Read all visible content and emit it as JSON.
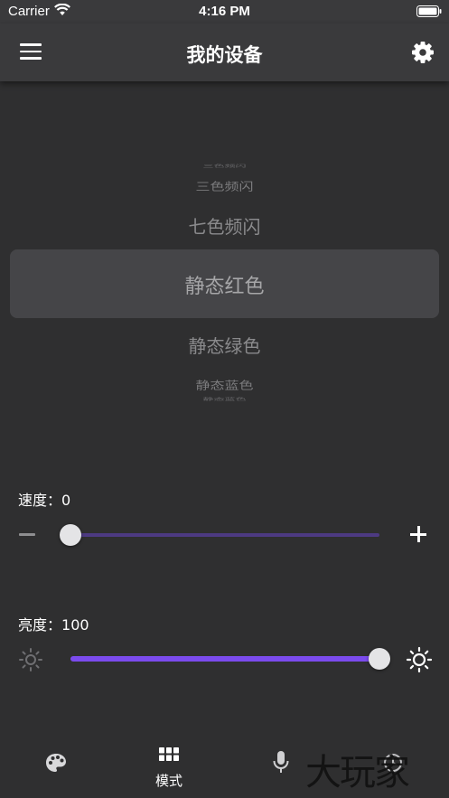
{
  "status_bar": {
    "carrier": "Carrier",
    "time": "4:16 PM"
  },
  "header": {
    "title": "我的设备"
  },
  "mode_picker": {
    "items": [
      "三色频闪",
      "三色频闪",
      "七色频闪",
      "静态红色",
      "静态绿色",
      "静态蓝色",
      "静态蓝色"
    ],
    "selected_index": 3
  },
  "speed": {
    "label": "速度：",
    "value": "0",
    "level": 0
  },
  "brightness": {
    "label": "亮度：",
    "value": "100",
    "level": 1
  },
  "tabs": [
    {
      "icon": "palette-icon",
      "label": ""
    },
    {
      "icon": "grid-icon",
      "label": "模式"
    },
    {
      "icon": "microphone-icon",
      "label": ""
    },
    {
      "icon": "timer-icon",
      "label": ""
    }
  ],
  "watermark": "大玩家",
  "colors": {
    "accent": "#7b4bed",
    "background": "#2f2f30",
    "bar": "#3a3a3c"
  }
}
